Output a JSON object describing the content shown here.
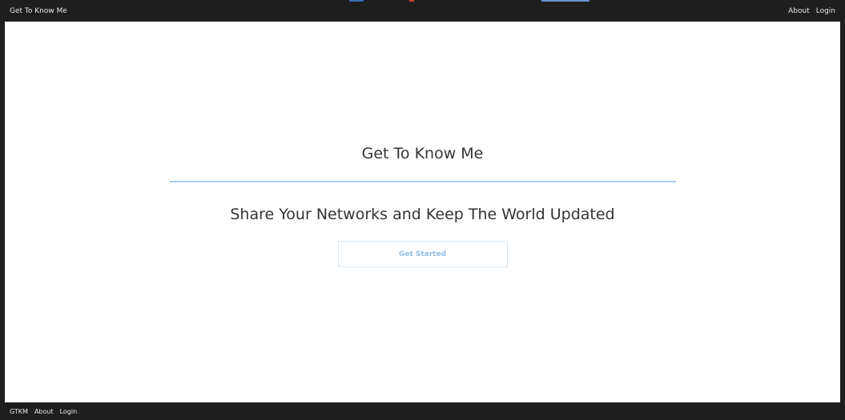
{
  "header": {
    "brand": "Get To Know Me",
    "nav": [
      "About",
      "Login"
    ],
    "accent_colors": [
      "#3a6fb0",
      "#d0402b",
      "#6a8fcf"
    ]
  },
  "hero": {
    "title": "Get To Know Me",
    "subtitle": "Share Your Networks and Keep The World Updated",
    "cta_label": "Get Started",
    "rule_color": "#a7c8ee"
  },
  "footer": {
    "links": [
      "GTKM",
      "About",
      "Login"
    ]
  }
}
